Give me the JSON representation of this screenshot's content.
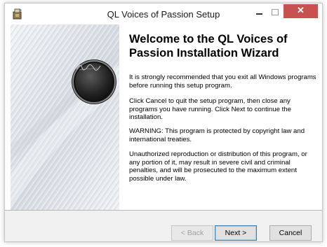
{
  "window": {
    "title": "QL Voices of Passion Setup",
    "close_glyph": "✕",
    "close_color": "#c75050"
  },
  "icons": {
    "app": "setup-installer-icon",
    "logo": "ql-voices-of-passion-logo"
  },
  "content": {
    "heading": "Welcome to the QL Voices of Passion Installation Wizard",
    "paragraphs": [
      "It is strongly recommended that you exit all Windows programs before running this setup program.",
      "Click Cancel to quit the setup program, then close any programs you have running.  Click Next to continue the installation.",
      "WARNING: This program is protected by copyright law and international treaties.",
      "Unauthorized reproduction or distribution of this program, or any portion of it, may result in severe civil and criminal penalties, and will be prosecuted to the maximum extent possible under law."
    ]
  },
  "buttons": {
    "back": "< Back",
    "next": "Next >",
    "cancel": "Cancel"
  }
}
